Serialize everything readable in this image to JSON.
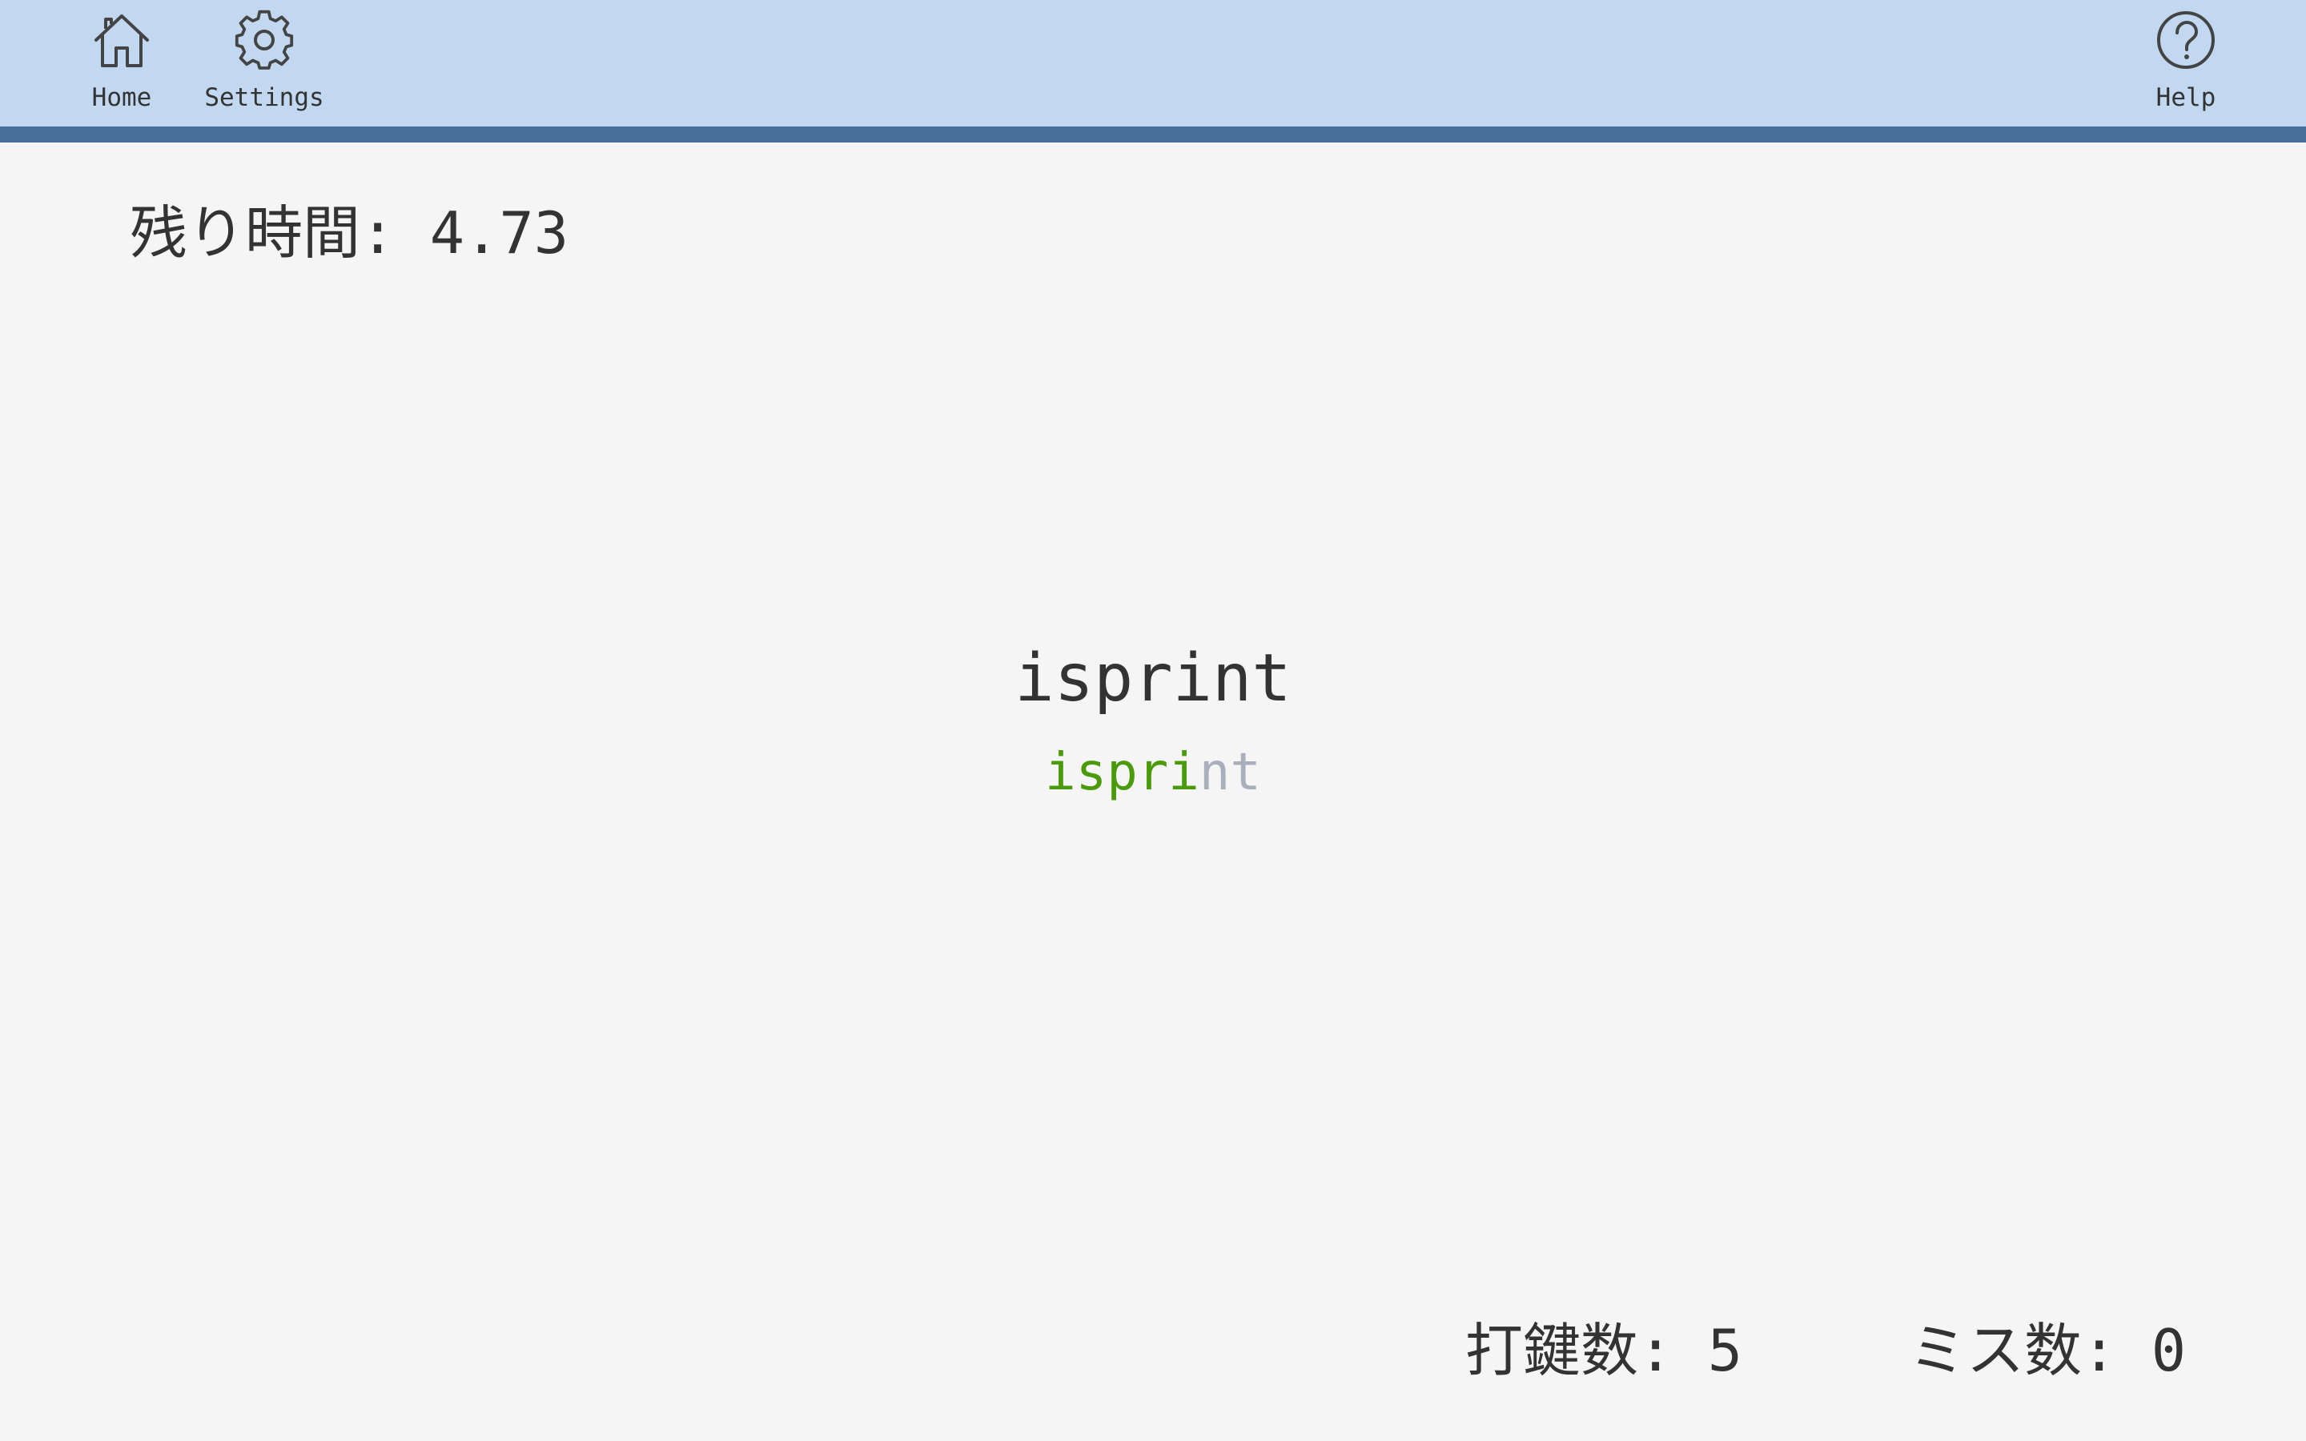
{
  "nav": {
    "home": {
      "label": "Home",
      "icon": "home-icon"
    },
    "settings": {
      "label": "Settings",
      "icon": "gear-icon"
    },
    "help": {
      "label": "Help",
      "icon": "help-icon"
    }
  },
  "game": {
    "timer_label": "残り時間: ",
    "timer_value": "4.73",
    "word": "isprint",
    "romaji_typed": "ispri",
    "romaji_remaining": "nt",
    "keystrokes_label": "打鍵数: ",
    "keystrokes_value": "5",
    "misses_label": "ミス数: ",
    "misses_value": "0"
  },
  "colors": {
    "header_bg": "#c1d8f0",
    "header_border": "#486d98",
    "page_bg": "#f5f5f5",
    "typed": "#4a9a0c",
    "untyped": "#a9b0bb",
    "text": "#333333"
  }
}
